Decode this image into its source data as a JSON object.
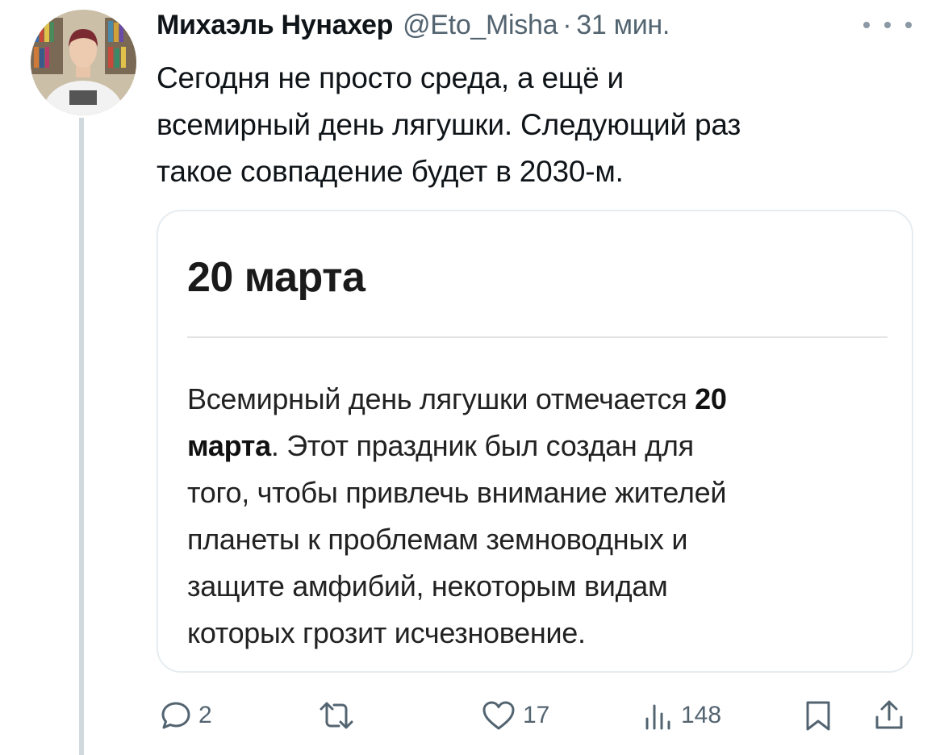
{
  "author": {
    "name": "Михаэль Нунахер",
    "handle": "@Eto_Misha",
    "separator": "·",
    "time": "31 мин."
  },
  "tweet": {
    "lines": [
      "Сегодня не просто среда, а ещё и",
      "всемирный день лягушки. Следующий раз",
      "такое совпадение будет в 2030-м."
    ]
  },
  "card": {
    "title": "20 марта",
    "body": {
      "line1_pre": "Всемирный день лягушки отмечается ",
      "line1_bold": "20",
      "line2_bold": "марта",
      "line2_post": ". Этот праздник был создан для",
      "line3": "того, чтобы привлечь внимание жителей",
      "line4": "планеты к проблемам земноводных и",
      "line5": "защите амфибий, некоторым видам",
      "line6": "которых грозит исчезновение."
    }
  },
  "actions": {
    "replies": "2",
    "retweets": "",
    "likes": "17",
    "views": "148"
  },
  "icons": {
    "reply": "reply-icon",
    "retweet": "retweet-icon",
    "like": "heart-icon",
    "views": "views-icon",
    "bookmark": "bookmark-icon",
    "share": "share-icon",
    "more": "more-icon"
  },
  "colors": {
    "text": "#0f1419",
    "secondary": "#536471",
    "thread_line": "#cfd9de",
    "card_border": "#e6ecf0"
  }
}
